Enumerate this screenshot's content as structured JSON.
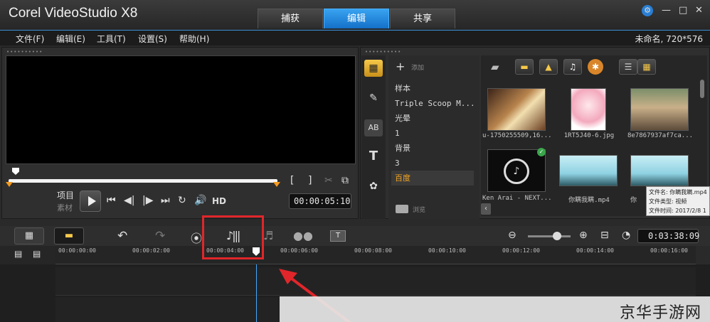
{
  "window": {
    "title": "Corel VideoStudio X8",
    "controls": {
      "settings": "⚙",
      "minimize": "—",
      "maximize": "□",
      "close": "✕"
    }
  },
  "tabs": [
    {
      "label": "捕获",
      "active": false
    },
    {
      "label": "编辑",
      "active": true
    },
    {
      "label": "共享",
      "active": false
    }
  ],
  "menu": {
    "items": [
      "文件(F)",
      "编辑(E)",
      "工具(T)",
      "设置(S)",
      "帮助(H)"
    ],
    "project_info": "未命名, 720*576"
  },
  "player": {
    "mode_project": "项目",
    "mode_clip": "素材",
    "timecode": "00:00:05:10",
    "hd_label": "HD",
    "bracket_in": "[",
    "bracket_out": "]"
  },
  "library": {
    "add_label": "添加",
    "browse_label": "浏览",
    "folders": [
      {
        "label": "样本",
        "selected": false
      },
      {
        "label": "Triple Scoop M...",
        "selected": false
      },
      {
        "label": "光晕",
        "selected": false
      },
      {
        "label": "1",
        "selected": false
      },
      {
        "label": "背景",
        "selected": false
      },
      {
        "label": "3",
        "selected": false
      },
      {
        "label": "百度",
        "selected": true
      }
    ],
    "items": [
      {
        "caption": "u-1750255509,16..."
      },
      {
        "caption": "1RT5J40-6.jpg"
      },
      {
        "caption": "8e7867937af7ca..."
      },
      {
        "caption": "Ken Arai - NEXT..."
      },
      {
        "caption": "你瞒我瞒.mp4"
      },
      {
        "caption": "你"
      }
    ],
    "tooltip": {
      "name": "文件名: 你瞒我瞒.mp4",
      "type": "文件类型: 视频",
      "time": "文件时间: 2017/2/8 1"
    }
  },
  "timeline": {
    "duration": "0:03:38:09",
    "ticks": [
      "00:00:00:00",
      "00:00:02:00",
      "00:00:04:00",
      "00:00:06:00",
      "00:00:08:00",
      "00:00:10:00",
      "00:00:12:00",
      "00:00:14:00",
      "00:00:16:00"
    ]
  },
  "watermark": "京华手游网",
  "colors": {
    "accent_blue": "#1f8fe8",
    "highlight_red": "#e0262a",
    "marker_orange": "#f59a1d",
    "selected_text": "#f5a623"
  }
}
